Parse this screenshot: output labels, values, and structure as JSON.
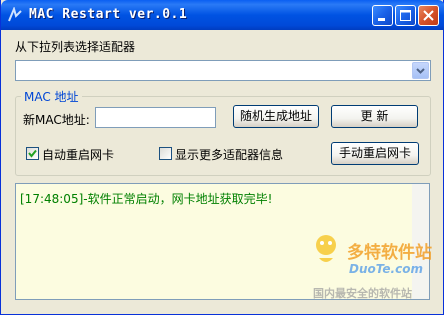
{
  "window": {
    "title": "MAC Restart ver.0.1"
  },
  "adapter_section": {
    "label": "从下拉列表选择适配器",
    "selected_value": ""
  },
  "group": {
    "title": "MAC 地址",
    "new_mac_label": "新MAC地址:",
    "new_mac_value": "",
    "random_button": "随机生成地址",
    "update_button": "更    新"
  },
  "options": {
    "auto_restart_label": "自动重启网卡",
    "auto_restart_checked": true,
    "show_more_label": "显示更多适配器信息",
    "show_more_checked": false,
    "manual_restart_button": "手动重启网卡"
  },
  "log": {
    "lines": [
      "[17:48:05]-软件正常启动，网卡地址获取完毕!"
    ]
  },
  "watermark": {
    "brand": "多特软件站",
    "url": "DuoTe.com",
    "slogan": "国内最安全的软件站"
  },
  "colors": {
    "title_bar": "#0053e3",
    "group_title": "#0046d5",
    "log_text": "#008000",
    "log_bg": "#fcfce0"
  }
}
